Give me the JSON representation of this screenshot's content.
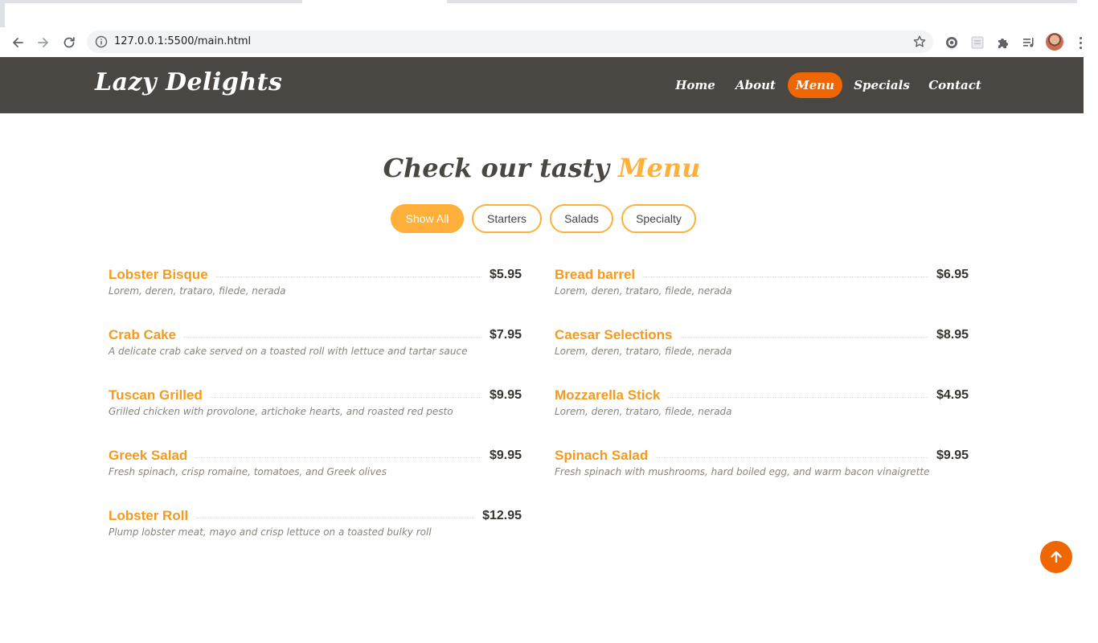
{
  "browser": {
    "url": "127.0.0.1:5500/main.html"
  },
  "site": {
    "logo": "Lazy Delights",
    "nav": {
      "home": "Home",
      "about": "About",
      "menu": "Menu",
      "specials": "Specials",
      "contact": "Contact",
      "active": "Menu",
      "accent_color": "#ef6603"
    }
  },
  "menu": {
    "title_main": "Check our tasty ",
    "title_accent": "Menu",
    "filters": {
      "all": "Show All",
      "starters": "Starters",
      "salads": "Salads",
      "specialty": "Specialty",
      "active": "Show All"
    },
    "items_left": [
      {
        "name": "Lobster Bisque",
        "price": "$5.95",
        "desc": "Lorem, deren, trataro, filede, nerada"
      },
      {
        "name": "Crab Cake",
        "price": "$7.95",
        "desc": "A delicate crab cake served on a toasted roll with lettuce and tartar sauce"
      },
      {
        "name": "Tuscan Grilled",
        "price": "$9.95",
        "desc": "Grilled chicken with provolone, artichoke hearts, and roasted red pesto"
      },
      {
        "name": "Greek Salad",
        "price": "$9.95",
        "desc": "Fresh spinach, crisp romaine, tomatoes, and Greek olives"
      },
      {
        "name": "Lobster Roll",
        "price": "$12.95",
        "desc": "Plump lobster meat, mayo and crisp lettuce on a toasted bulky roll"
      }
    ],
    "items_right": [
      {
        "name": "Bread barrel",
        "price": "$6.95",
        "desc": "Lorem, deren, trataro, filede, nerada"
      },
      {
        "name": "Caesar Selections",
        "price": "$8.95",
        "desc": "Lorem, deren, trataro, filede, nerada"
      },
      {
        "name": "Mozzarella Stick",
        "price": "$4.95",
        "desc": "Lorem, deren, trataro, filede, nerada"
      },
      {
        "name": "Spinach Salad",
        "price": "$9.95",
        "desc": "Fresh spinach with mushrooms, hard boiled egg, and warm bacon vinaigrette"
      }
    ]
  },
  "colors": {
    "header_bg": "#4a4641",
    "accent_orange": "#ffb03b",
    "item_name": "#f49a1e",
    "back_to_top": "#ef6603"
  },
  "icons": {
    "back": "arrow-left-icon",
    "forward": "arrow-right-icon",
    "reload": "reload-icon",
    "info": "info-icon",
    "star": "star-icon",
    "extensions": [
      "gear-extension-icon",
      "page-extension-icon",
      "puzzle-icon",
      "media-playlist-icon"
    ],
    "back_to_top": "arrow-up-icon"
  }
}
